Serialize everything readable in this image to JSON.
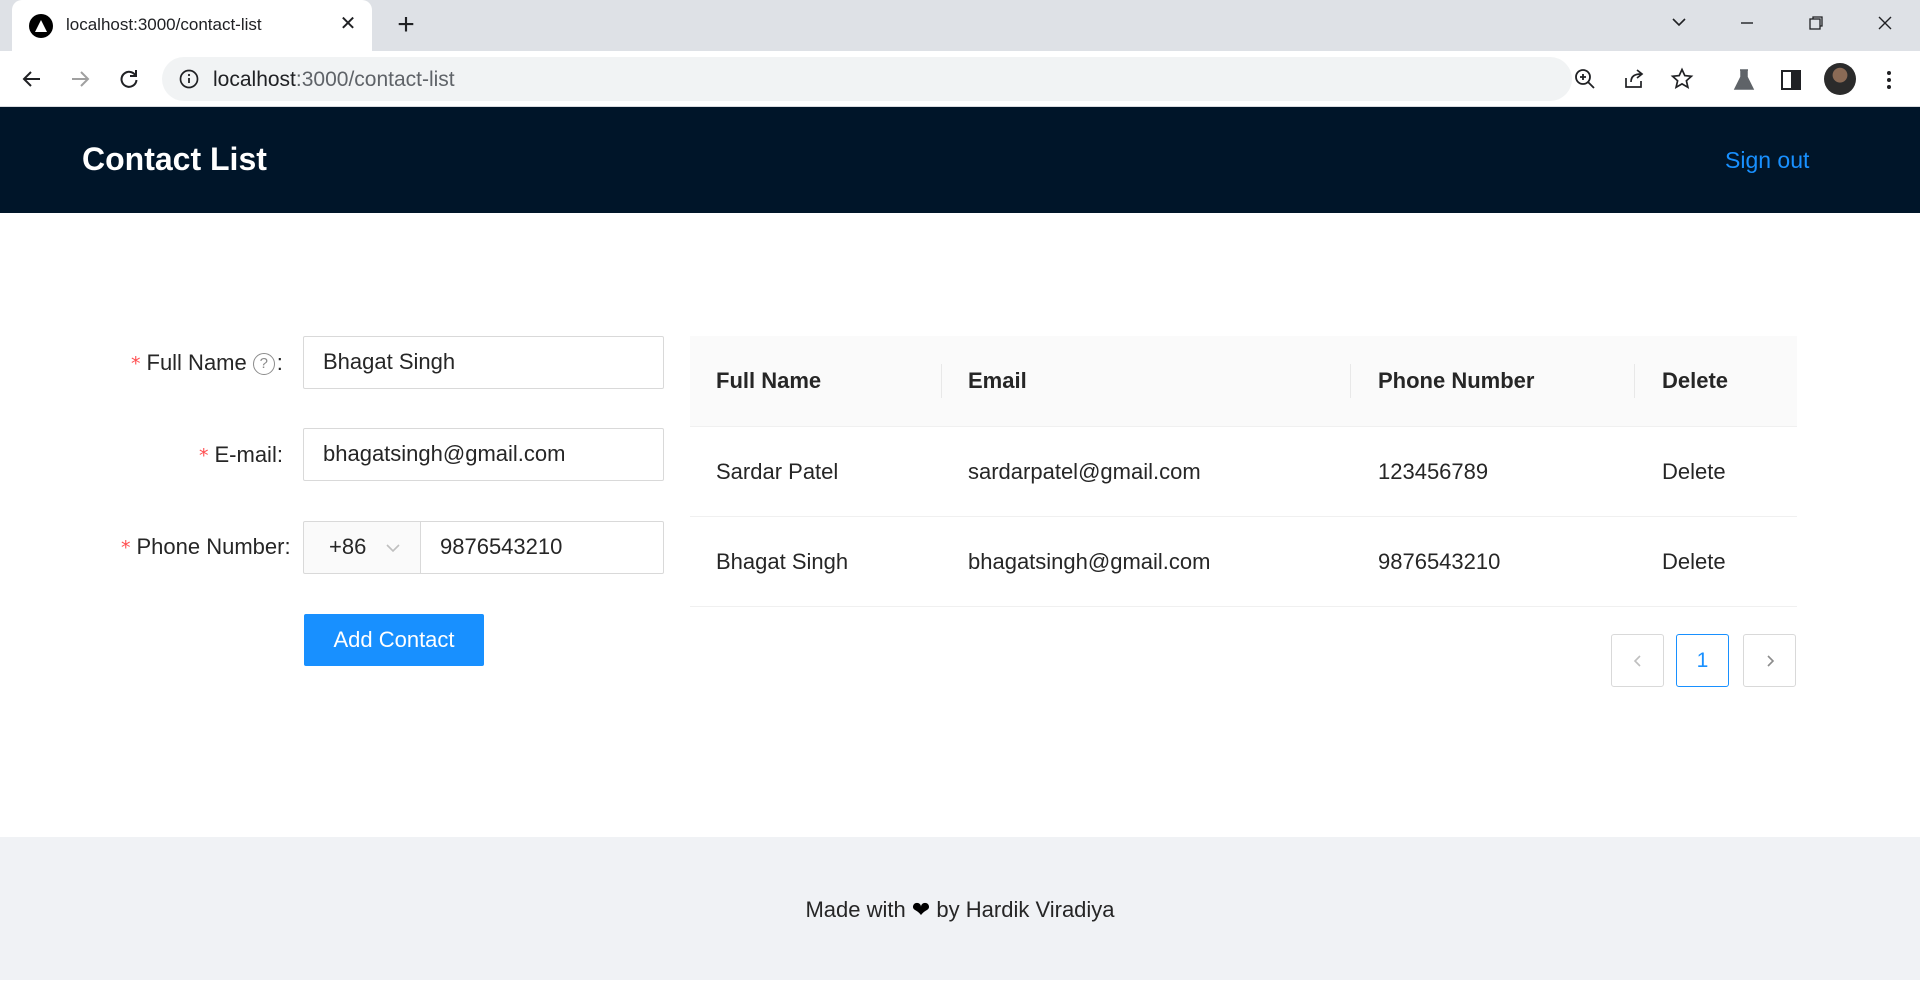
{
  "browser": {
    "tab_title": "localhost:3000/contact-list",
    "url_host": "localhost",
    "url_path": ":3000/contact-list",
    "close_glyph": "✕",
    "newtab_glyph": "+"
  },
  "header": {
    "title": "Contact List",
    "signout_label": "Sign out"
  },
  "form": {
    "full_name_label": "Full Name",
    "full_name_value": "Bhagat Singh",
    "email_label": "E-mail",
    "email_value": "bhagatsingh@gmail.com",
    "phone_label": "Phone Number",
    "phone_prefix": "+86",
    "phone_value": "9876543210",
    "submit_label": "Add Contact",
    "required_mark": "*",
    "colon": ":",
    "help_glyph": "?"
  },
  "table": {
    "columns": [
      "Full Name",
      "Email",
      "Phone Number",
      "Delete"
    ],
    "rows": [
      {
        "name": "Sardar Patel",
        "email": "sardarpatel@gmail.com",
        "phone": "123456789",
        "action": "Delete"
      },
      {
        "name": "Bhagat Singh",
        "email": "bhagatsingh@gmail.com",
        "phone": "9876543210",
        "action": "Delete"
      }
    ]
  },
  "pagination": {
    "current_page": "1"
  },
  "footer": {
    "prefix": "Made with",
    "heart": "❤",
    "suffix": "by Hardik Viradiya"
  },
  "colors": {
    "header_bg": "#001529",
    "primary": "#1890ff",
    "required": "#ff4d4f",
    "footer_bg": "#f0f2f5"
  },
  "icons": [
    "tab-favicon-icon",
    "close-icon",
    "plus-icon",
    "chevron-down-icon",
    "minimize-icon",
    "restore-icon",
    "window-close-icon",
    "back-icon",
    "forward-icon",
    "reload-icon",
    "info-icon",
    "zoom-icon",
    "share-icon",
    "star-icon",
    "flask-icon",
    "side-panel-icon",
    "kebab-menu-icon",
    "help-icon",
    "chevron-left-icon",
    "chevron-right-icon",
    "heart-icon"
  ]
}
